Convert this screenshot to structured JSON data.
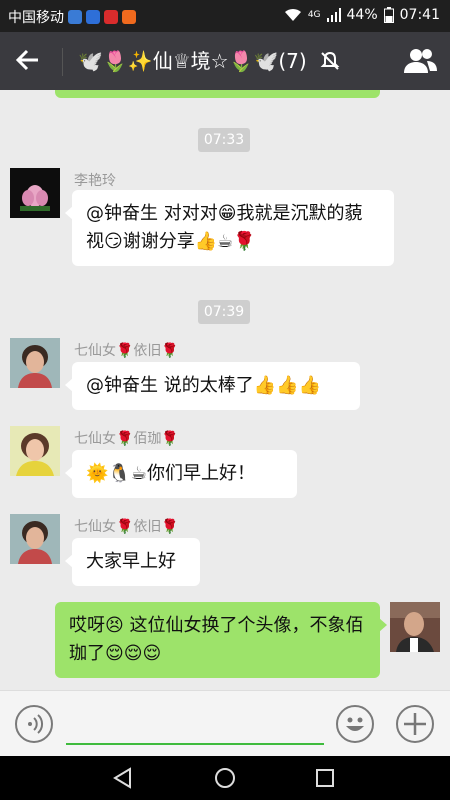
{
  "status": {
    "carrier": "中国移动",
    "network": "4G",
    "battery": "44%",
    "time": "07:41"
  },
  "header": {
    "title": "🕊️🌷✨仙♕境☆🌷🕊️(7)"
  },
  "messages": [
    {
      "type": "time",
      "text": "07:33"
    },
    {
      "type": "in",
      "sender": "李艳玲",
      "text": "@钟奋生 对对对😁我就是沉默的藐视😏谢谢分享👍☕🌹"
    },
    {
      "type": "time",
      "text": "07:39"
    },
    {
      "type": "in",
      "sender": "七仙女🌹依旧🌹",
      "text": "@钟奋生 说的太棒了👍👍👍"
    },
    {
      "type": "in",
      "sender": "七仙女🌹佰珈🌹",
      "text": "🌞🐧☕你们早上好！"
    },
    {
      "type": "in",
      "sender": "七仙女🌹依旧🌹",
      "text": "大家早上好"
    },
    {
      "type": "out",
      "text": "哎呀😣 这位仙女换了个头像，不象佰珈了😌😌😌"
    }
  ]
}
